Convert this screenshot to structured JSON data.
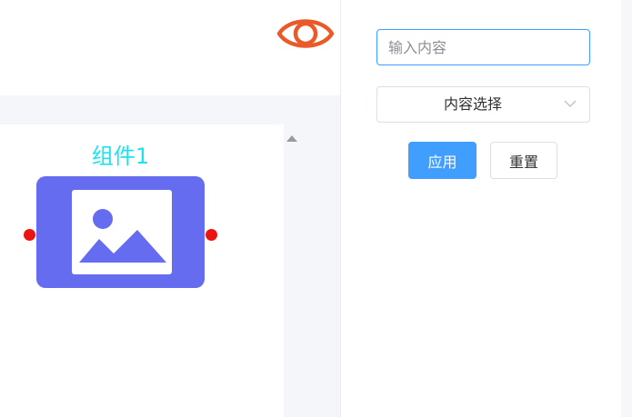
{
  "toolbar": {
    "preview_icon": "eye-icon",
    "icon_color": "#e95a28"
  },
  "canvas": {
    "node": {
      "title": "组件1",
      "title_color": "#1ee3ee",
      "fill_color": "#666cf0",
      "icon": "image-icon",
      "port_color": "#ee1313"
    }
  },
  "panel": {
    "search": {
      "placeholder": "输入内容",
      "value": ""
    },
    "select": {
      "value": "内容选择",
      "arrow_icon": "chevron-down-icon"
    },
    "apply_label": "应用",
    "reset_label": "重置",
    "accent_color": "#409eff"
  }
}
